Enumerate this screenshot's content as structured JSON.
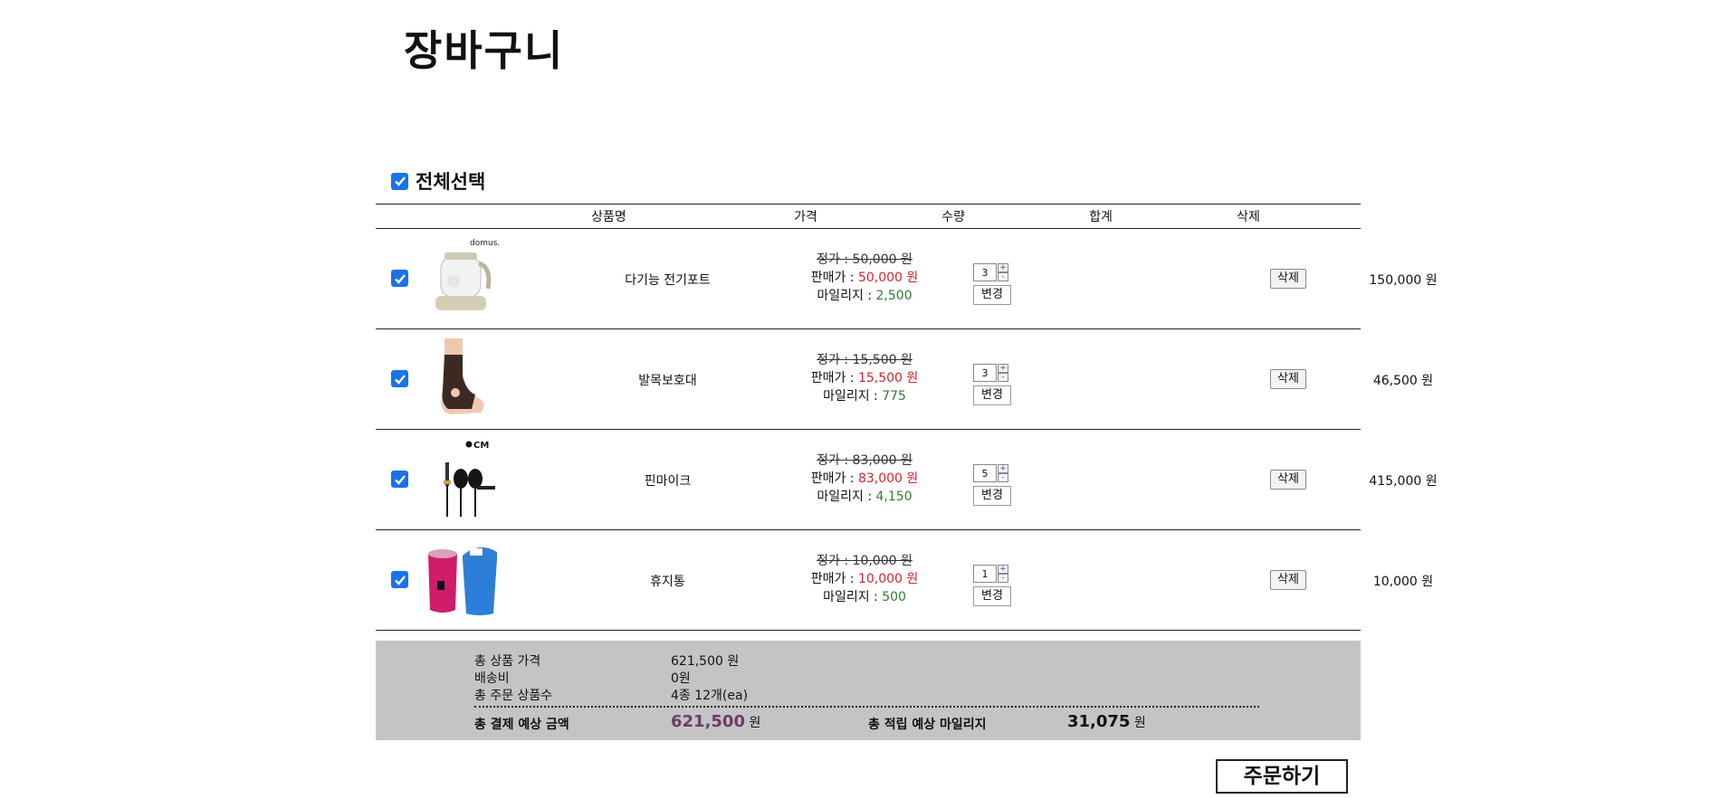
{
  "page": {
    "title": "장바구니"
  },
  "select_all": {
    "label": "전체선택",
    "checked": true
  },
  "table": {
    "headers": {
      "name": "상품명",
      "price": "가격",
      "qty": "수량",
      "sum": "합계",
      "delete": "삭제"
    }
  },
  "labels": {
    "list_price": "정가 : ",
    "sale_price": "판매가 : ",
    "mileage": "마일리지 : ",
    "change": "변경",
    "delete": "삭제",
    "plus": "+",
    "minus": "-"
  },
  "items": [
    {
      "name": "다기능 전기포트",
      "list_price": "50,000 원",
      "sale_price": "50,000 원",
      "mileage": "2,500",
      "qty": "3",
      "sum": "150,000 원",
      "thumb": "electric-kettle",
      "thumb_brand": "domus."
    },
    {
      "name": "발목보호대",
      "list_price": "15,500 원",
      "sale_price": "15,500 원",
      "mileage": "775",
      "qty": "3",
      "sum": "46,500 원",
      "thumb": "ankle-support"
    },
    {
      "name": "핀마이크",
      "list_price": "83,000 원",
      "sale_price": "83,000 원",
      "mileage": "4,150",
      "qty": "5",
      "sum": "415,000 원",
      "thumb": "pin-microphone",
      "thumb_brand": "CM"
    },
    {
      "name": "휴지통",
      "list_price": "10,000 원",
      "sale_price": "10,000 원",
      "mileage": "500",
      "qty": "1",
      "sum": "10,000 원",
      "thumb": "trash-bins"
    }
  ],
  "summary": {
    "total_price_label": "총 상품 가격",
    "total_price": "621,500 원",
    "shipping_label": "배송비",
    "shipping": "0원",
    "count_label": "총 주문 상품수",
    "count": "4종 12개(ea)",
    "payment_label": "총 결제 예상 금액",
    "payment": "621,500",
    "payment_unit": "원",
    "mileage_label": "총 적립 예상 마일리지",
    "mileage": "31,075",
    "mileage_unit": "원"
  },
  "order_button": {
    "label": "주문하기"
  },
  "colors": {
    "checkbox": "#1a73e8",
    "sale": "#d9232d",
    "mileage": "#2e7d32",
    "summary_bg": "#c4c4c4",
    "payment": "#6e3b69"
  }
}
